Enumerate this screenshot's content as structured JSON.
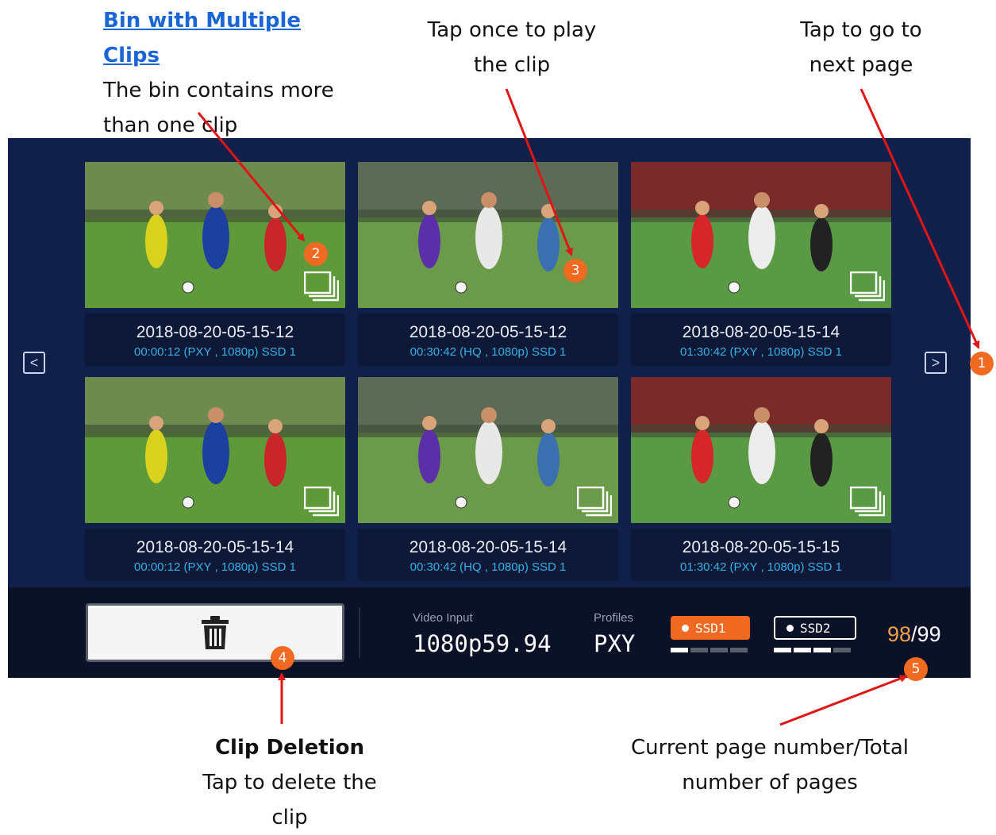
{
  "annotations": {
    "bin_title": "Bin with Multiple Clips",
    "bin_line1": "The bin contains more",
    "bin_line2": "than one clip",
    "play_line1": "Tap once to play",
    "play_line2": "the clip",
    "next_line1": "Tap to go to",
    "next_line2": "next page",
    "delete_title": "Clip Deletion",
    "delete_line1": "Tap to delete the clip",
    "page_line1": "Current page number/Total",
    "page_line2": "number of pages"
  },
  "markers": [
    "1",
    "2",
    "3",
    "4",
    "5"
  ],
  "clips": [
    {
      "name": "2018-08-20-05-15-12",
      "info": "00:00:12 (PXY , 1080p) SSD 1",
      "multi": true
    },
    {
      "name": "2018-08-20-05-15-12",
      "info": "00:30:42 (HQ , 1080p) SSD 1",
      "multi": false
    },
    {
      "name": "2018-08-20-05-15-14",
      "info": "01:30:42 (PXY , 1080p) SSD 1",
      "multi": true
    },
    {
      "name": "2018-08-20-05-15-14",
      "info": "00:00:12 (PXY , 1080p) SSD 1",
      "multi": true
    },
    {
      "name": "2018-08-20-05-15-14",
      "info": "00:30:42 (HQ , 1080p) SSD 1",
      "multi": true
    },
    {
      "name": "2018-08-20-05-15-15",
      "info": "01:30:42 (PXY , 1080p) SSD 1",
      "multi": true
    }
  ],
  "nav": {
    "prev": "<",
    "next": ">"
  },
  "status": {
    "video_input_label": "Video Input",
    "video_input_value": "1080p59.94",
    "profiles_label": "Profiles",
    "profiles_value": "PXY",
    "ssd1_label": "SSD1",
    "ssd2_label": "SSD2",
    "page_current": "98",
    "page_total": "/99"
  },
  "colors": {
    "accent": "#f06a22",
    "panel": "#10204a",
    "info_text": "#34b0e8",
    "arrow": "#e01515"
  },
  "icons": {
    "delete": "trash-icon",
    "multi": "multi-clip-stack-icon"
  }
}
